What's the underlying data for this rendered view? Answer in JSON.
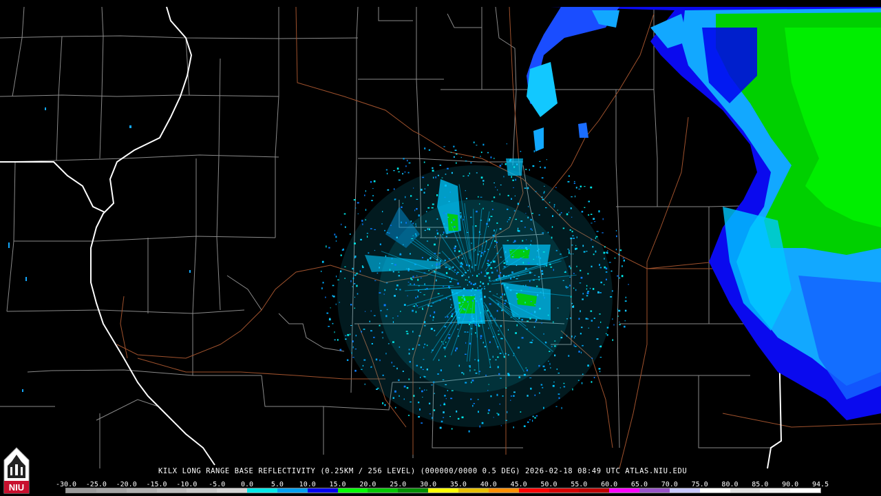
{
  "caption": "KILX LONG RANGE BASE REFLECTIVITY (0.25KM / 256 LEVEL) (000000/0000 0.5 DEG) 2026-02-18 08:49 UTC  ATLAS.NIU.EDU",
  "legend": {
    "labels": [
      "-30.0",
      "-25.0",
      "-20.0",
      "-15.0",
      "-10.0",
      "-5.0",
      "0.0",
      "5.0",
      "10.0",
      "15.0",
      "20.0",
      "25.0",
      "30.0",
      "35.0",
      "40.0",
      "45.0",
      "50.0",
      "55.0",
      "60.0",
      "65.0",
      "70.0",
      "75.0",
      "80.0",
      "85.0",
      "90.0",
      "94.5"
    ],
    "colors": [
      "#9a9a9a",
      "#a5a5a5",
      "#b0b0b0",
      "#bcbcbc",
      "#c8c8c8",
      "#d4d4d4",
      "#00e8e8",
      "#00a0f0",
      "#0000f0",
      "#00ff00",
      "#00c800",
      "#009000",
      "#ffff00",
      "#e7c000",
      "#ff9000",
      "#ff0000",
      "#d60000",
      "#c00000",
      "#ff00ff",
      "#9955c9",
      "#c8c8ff",
      "#ffffff",
      "#e0e0e0",
      "#f0f0f0",
      "#ffffff"
    ]
  },
  "logo": {
    "text": "NIU",
    "icon": "niu-tower-logo"
  },
  "colors": {
    "background": "#000000",
    "county_lines": "#8a8a8a",
    "state_lines": "#ffffff",
    "roads": "#a0522d"
  }
}
